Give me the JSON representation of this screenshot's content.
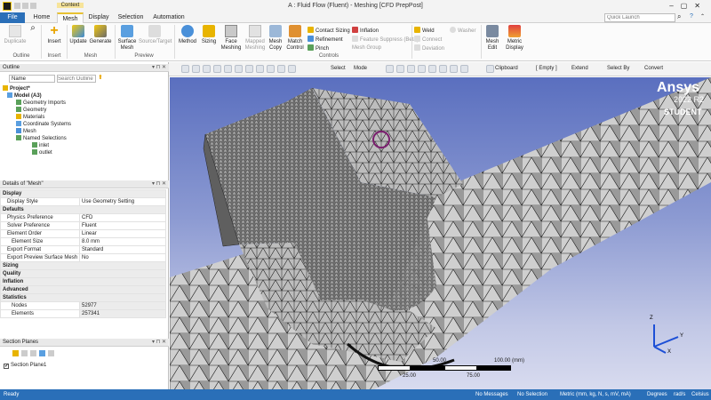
{
  "window": {
    "title": "A : Fluid Flow (Fluent) - Meshing [CFD PrepPost]"
  },
  "context_label": "Context",
  "tabs": [
    {
      "label": "File"
    },
    {
      "label": "Home"
    },
    {
      "label": "Mesh"
    },
    {
      "label": "Display"
    },
    {
      "label": "Selection"
    },
    {
      "label": "Automation"
    }
  ],
  "quick_launch": {
    "placeholder": "Quick Launch"
  },
  "ribbon": {
    "duplicate": "Duplicate",
    "insert": "Insert",
    "update": "Update",
    "generate": "Generate",
    "surface_mesh": "Surface Mesh",
    "source_target": "Source/Target",
    "method": "Method",
    "sizing": "Sizing",
    "face_meshing": "Face Meshing",
    "mapped_meshing": "Mapped Meshing",
    "mesh_copy": "Mesh Copy",
    "match_control": "Match Control",
    "contact_sizing": "Contact Sizing",
    "refinement": "Refinement",
    "pinch": "Pinch",
    "inflation": "Inflation",
    "feature_suppress": "Feature Suppress (Beta)",
    "mesh_group": "Mesh Group",
    "weld": "Weld",
    "connect": "Connect",
    "deviation": "Deviation",
    "washer": "Washer",
    "mesh_edit": "Mesh Edit",
    "metric_display": "Metric Display",
    "groups": {
      "outline": "Outline",
      "insert": "Insert",
      "mesh": "Mesh",
      "preview": "Preview",
      "controls": "Controls"
    }
  },
  "graphics_toolbar": {
    "select": "Select",
    "mode": "Mode",
    "clipboard": "Clipboard",
    "empty": "[ Empty ]",
    "extend": "Extend",
    "select_by": "Select By",
    "convert": "Convert"
  },
  "outline": {
    "title": "Outline",
    "name_filter": "Name",
    "search_placeholder": "Search Outline",
    "items": [
      {
        "label": "Project*"
      },
      {
        "label": "Model (A3)"
      },
      {
        "label": "Geometry Imports"
      },
      {
        "label": "Geometry"
      },
      {
        "label": "Materials"
      },
      {
        "label": "Coordinate Systems"
      },
      {
        "label": "Mesh"
      },
      {
        "label": "Named Selections"
      },
      {
        "label": "inlet"
      },
      {
        "label": "outlet"
      }
    ]
  },
  "details": {
    "title": "Details of \"Mesh\"",
    "sections": {
      "display": "Display",
      "defaults": "Defaults",
      "sizing": "Sizing",
      "quality": "Quality",
      "inflation": "Inflation",
      "advanced": "Advanced",
      "statistics": "Statistics"
    },
    "rows": {
      "display_style": {
        "key": "Display Style",
        "value": "Use Geometry Setting"
      },
      "physics_preference": {
        "key": "Physics Preference",
        "value": "CFD"
      },
      "solver_preference": {
        "key": "Solver Preference",
        "value": "Fluent"
      },
      "element_order": {
        "key": "Element Order",
        "value": "Linear"
      },
      "element_size": {
        "key": "Element Size",
        "value": "8.0 mm"
      },
      "export_format": {
        "key": "Export Format",
        "value": "Standard"
      },
      "export_preview": {
        "key": "Export Preview Surface Mesh",
        "value": "No"
      },
      "nodes": {
        "key": "Nodes",
        "value": "52977"
      },
      "elements": {
        "key": "Elements",
        "value": "257341"
      }
    }
  },
  "section_planes": {
    "title": "Section Planes",
    "items": [
      {
        "label": "Section Plane1"
      }
    ]
  },
  "viewport": {
    "brand": "Ansys",
    "version": "2022 R2",
    "edition": "STUDENT",
    "scale_top": [
      "0.00",
      "50.00",
      "100.00 (mm)"
    ],
    "scale_bottom": [
      "25.00",
      "75.00"
    ],
    "axes": {
      "x": "X",
      "y": "Y",
      "z": "Z"
    }
  },
  "status": {
    "ready": "Ready",
    "messages": "No Messages",
    "selection": "No Selection",
    "units": "Metric (mm, kg, N, s, mV, mA)",
    "angle": "Degrees",
    "rate": "rad/s",
    "temp": "Celsius"
  },
  "colors": {
    "accent": "#2a6fb8",
    "context_tab": "#e8c233",
    "brand_red": "#f2c811"
  }
}
